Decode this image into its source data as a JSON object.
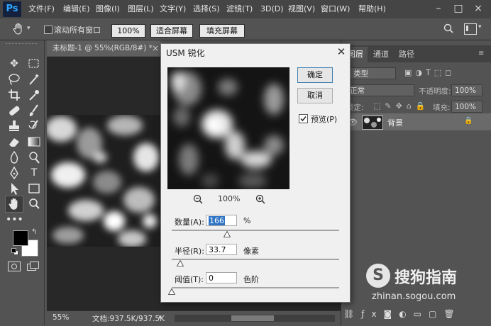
{
  "app": {
    "logo": "Ps"
  },
  "menubar": {
    "items": [
      "文件(F)",
      "编辑(E)",
      "图像(I)",
      "图层(L)",
      "文字(Y)",
      "选择(S)",
      "滤镜(T)",
      "3D(D)",
      "视图(V)",
      "窗口(W)",
      "帮助(H)"
    ],
    "window_controls": [
      "–",
      "□",
      "×"
    ]
  },
  "options_bar": {
    "scroll_all_label": "滚动所有窗口",
    "zoom_100": "100%",
    "fit_screen": "适合屏幕",
    "fill_screen": "填充屏幕"
  },
  "document": {
    "tab_title": "未标题-1 @ 55%(RGB/8#) *",
    "zoom": "55%",
    "doc_info": "文档:937.5K/937.5K"
  },
  "dialog": {
    "title": "USM 锐化",
    "ok": "确定",
    "cancel": "取消",
    "preview_label": "预览(P)",
    "preview_checked": true,
    "preview_zoom": "100%",
    "amount_label": "数量(A):",
    "amount_value": "166",
    "amount_unit": "%",
    "amount_fraction": 0.33,
    "radius_label": "半径(R):",
    "radius_value": "33.7",
    "radius_unit": "像素",
    "radius_fraction": 0.05,
    "threshold_label": "阈值(T):",
    "threshold_value": "0",
    "threshold_unit": "色阶",
    "threshold_fraction": 0
  },
  "panels": {
    "tabs": [
      "图层",
      "通道",
      "路径"
    ],
    "kind_label": "类型",
    "blend_mode": "正常",
    "opacity_label": "不透明度:",
    "opacity_value": "100%",
    "lock_label": "锁定:",
    "fill_label": "填充:",
    "fill_value": "100%",
    "layer_name": "背景"
  },
  "watermark": {
    "brand": "搜狗指南",
    "url": "zhinan.sogou.com"
  }
}
